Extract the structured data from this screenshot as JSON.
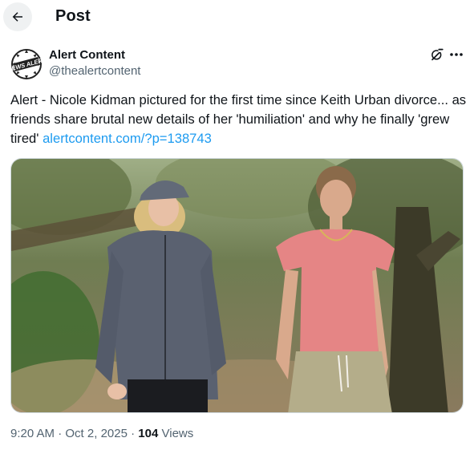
{
  "header": {
    "title": "Post"
  },
  "author": {
    "name": "Alert Content",
    "handle": "@thealertcontent",
    "avatar_text": "NEWS ALERT"
  },
  "tweet": {
    "text": "Alert - Nicole Kidman pictured for the first time since Keith Urban divorce... as friends share brutal new details of her 'humiliation' and why he finally 'grew tired' ",
    "link": "alertcontent.com/?p=138743"
  },
  "meta": {
    "time": "9:20 AM",
    "separator": "·",
    "date": "Oct 2, 2025",
    "views_count": "104",
    "views_label": "Views"
  },
  "colors": {
    "link": "#1d9bf0",
    "secondary_text": "#536471",
    "primary_text": "#0f1419"
  },
  "icons": [
    "back-arrow-icon",
    "grok-icon",
    "more-icon"
  ]
}
